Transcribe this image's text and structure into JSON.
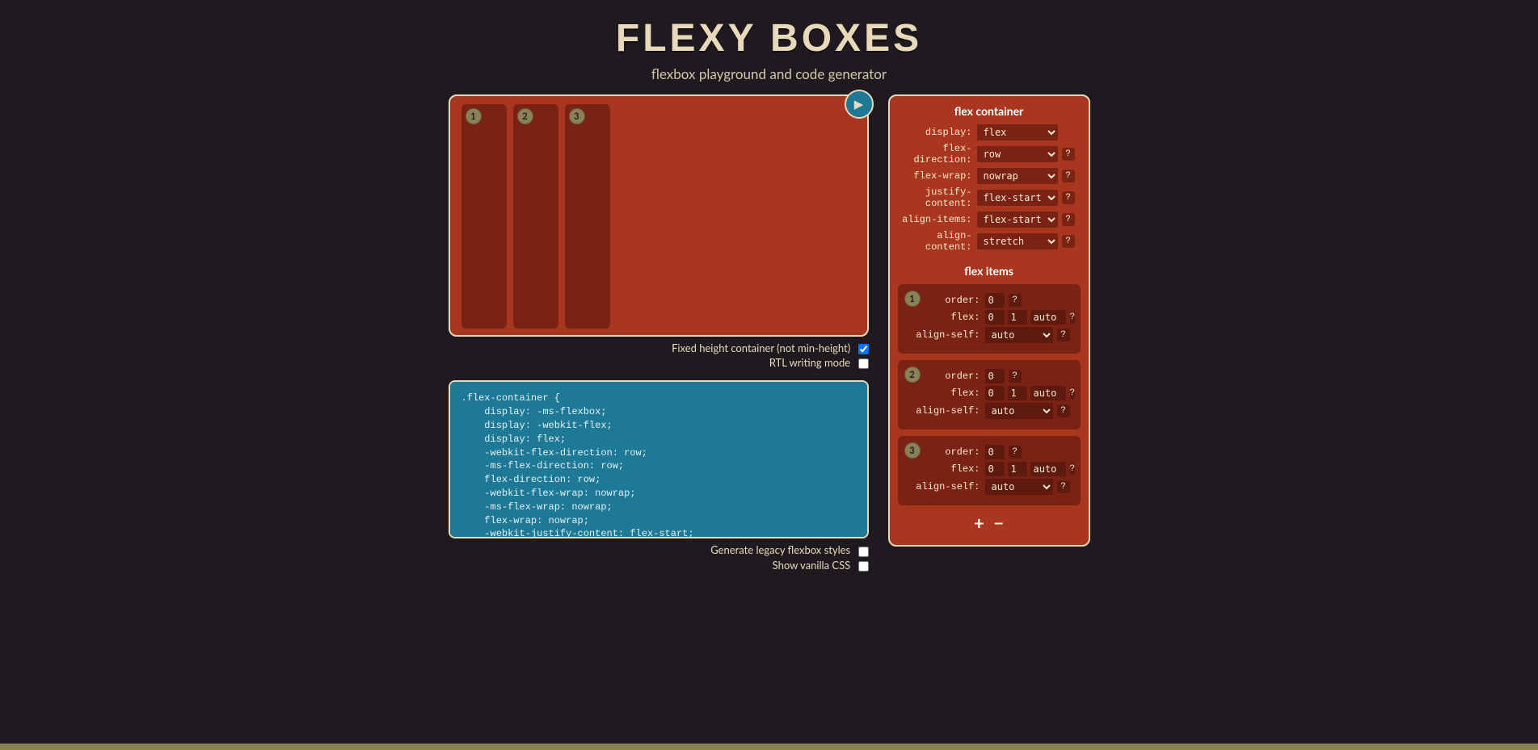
{
  "header": {
    "logo": "FLEXY BOXES",
    "subtitle": "flexbox playground and code generator"
  },
  "preview": {
    "items": [
      "1",
      "2",
      "3"
    ]
  },
  "checkboxes": {
    "fixed_height": {
      "label": "Fixed height container (not min-height)",
      "checked": true
    },
    "rtl": {
      "label": "RTL writing mode",
      "checked": false
    },
    "legacy": {
      "label": "Generate legacy flexbox styles",
      "checked": false
    },
    "vanilla": {
      "label": "Show vanilla CSS",
      "checked": false
    }
  },
  "code": ".flex-container {\n    display: -ms-flexbox;\n    display: -webkit-flex;\n    display: flex;\n    -webkit-flex-direction: row;\n    -ms-flex-direction: row;\n    flex-direction: row;\n    -webkit-flex-wrap: nowrap;\n    -ms-flex-wrap: nowrap;\n    flex-wrap: nowrap;\n    -webkit-justify-content: flex-start;\n    -ms-flex-pack: start;\n    justify-content: flex-start;\n    -webkit-align-content: stretch;\n    -ms-flex-line-pack: stretch;\n    align-content: stretch;",
  "controls": {
    "container_title": "flex container",
    "items_title": "flex items",
    "labels": {
      "display": "display:",
      "flex_direction": "flex-direction:",
      "flex_wrap": "flex-wrap:",
      "justify_content": "justify-content:",
      "align_items": "align-items:",
      "align_content": "align-content:",
      "order": "order:",
      "flex": "flex:",
      "align_self": "align-self:"
    },
    "values": {
      "display": "flex",
      "flex_direction": "row",
      "flex_wrap": "nowrap",
      "justify_content": "flex-start",
      "align_items": "flex-start",
      "align_content": "stretch"
    },
    "items": [
      {
        "num": "1",
        "order": "0",
        "grow": "0",
        "shrink": "1",
        "basis": "auto",
        "align_self": "auto"
      },
      {
        "num": "2",
        "order": "0",
        "grow": "0",
        "shrink": "1",
        "basis": "auto",
        "align_self": "auto"
      },
      {
        "num": "3",
        "order": "0",
        "grow": "0",
        "shrink": "1",
        "basis": "auto",
        "align_self": "auto"
      }
    ],
    "help": "?",
    "plus": "+",
    "minus": "−"
  }
}
